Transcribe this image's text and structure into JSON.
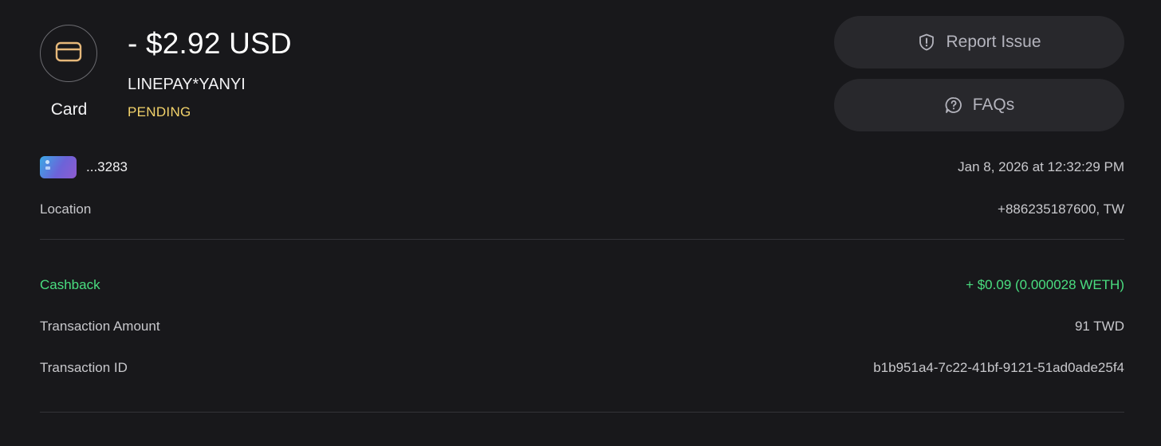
{
  "transaction": {
    "type_label": "Card",
    "amount": "- $2.92 USD",
    "merchant": "LINEPAY*YANYI",
    "status": "PENDING"
  },
  "actions": {
    "report_label": "Report Issue",
    "faq_label": "FAQs"
  },
  "card": {
    "last4": "...3283",
    "datetime": "Jan 8, 2026 at 12:32:29 PM"
  },
  "location": {
    "label": "Location",
    "value": "+886235187600, TW"
  },
  "details": {
    "cashback_label": "Cashback",
    "cashback_value": "+ $0.09 (0.000028 WETH)",
    "amount_label": "Transaction Amount",
    "amount_value": "91 TWD",
    "id_label": "Transaction ID",
    "id_value": "b1b951a4-7c22-41bf-9121-51ad0ade25f4"
  },
  "colors": {
    "background": "#18181b",
    "pending": "#f3d36b",
    "cashback": "#4ade80",
    "button_bg": "#28282c",
    "card_icon": "#e6b87a"
  },
  "icons": {
    "type": "credit-card-icon",
    "report": "shield-alert-icon",
    "faq": "help-chat-icon"
  }
}
